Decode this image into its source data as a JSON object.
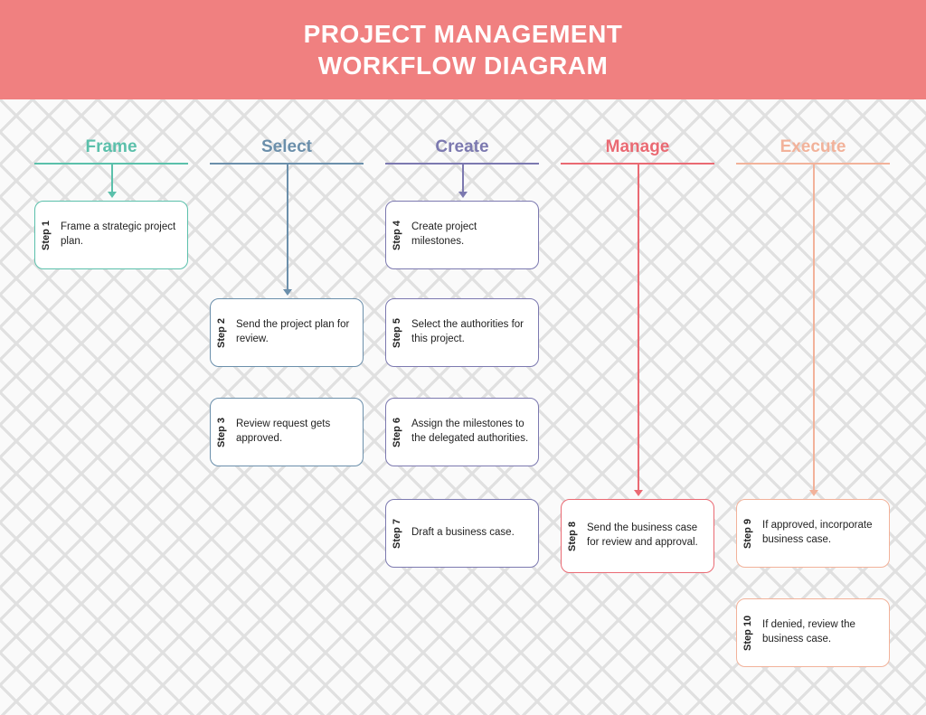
{
  "title_line1": "PROJECT MANAGEMENT",
  "title_line2": "WORKFLOW DIAGRAM",
  "columns": {
    "frame": {
      "label": "Frame",
      "color": "#5bc0ab"
    },
    "select": {
      "label": "Select",
      "color": "#6b8fab"
    },
    "create": {
      "label": "Create",
      "color": "#7c79b0"
    },
    "manage": {
      "label": "Manage",
      "color": "#ea6a73"
    },
    "execute": {
      "label": "Execute",
      "color": "#f2b29a"
    }
  },
  "steps": {
    "s1": {
      "label": "Step 1",
      "text": "Frame a strategic project plan."
    },
    "s2": {
      "label": "Step 2",
      "text": "Send the project plan for review."
    },
    "s3": {
      "label": "Step 3",
      "text": "Review request gets approved."
    },
    "s4": {
      "label": "Step 4",
      "text": "Create project milestones."
    },
    "s5": {
      "label": "Step 5",
      "text": "Select the authorities for this project."
    },
    "s6": {
      "label": "Step 6",
      "text": "Assign the milestones to the delegated authorities."
    },
    "s7": {
      "label": "Step 7",
      "text": "Draft a business case."
    },
    "s8": {
      "label": "Step 8",
      "text": "Send the business case for review and approval."
    },
    "s9": {
      "label": "Step 9",
      "text": "If approved, incorporate business case."
    },
    "s10": {
      "label": "Step 10",
      "text": "If denied, review the business case."
    }
  }
}
